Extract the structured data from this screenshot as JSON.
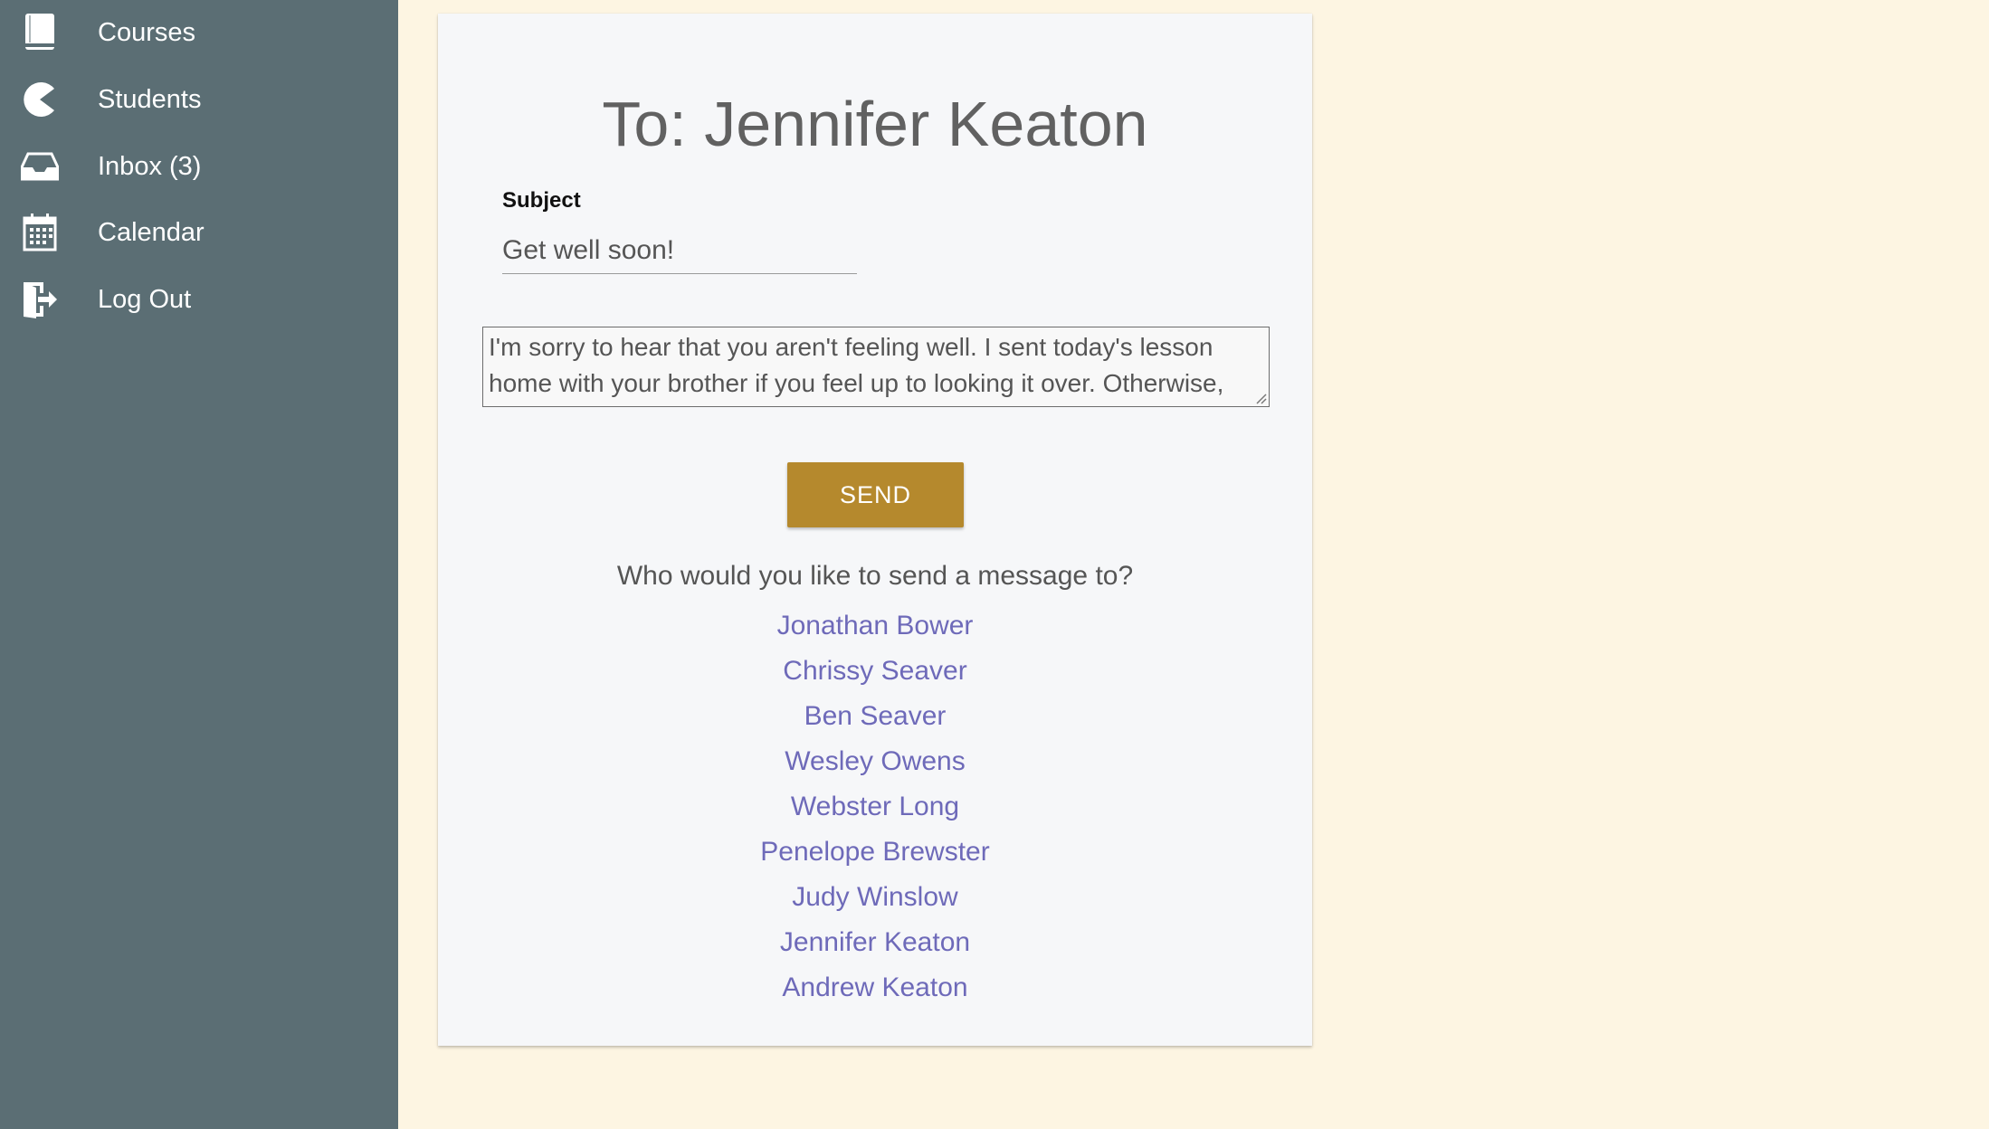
{
  "sidebar": {
    "items": [
      {
        "label": "Courses",
        "icon": "book-icon"
      },
      {
        "label": "Students",
        "icon": "pacman-icon"
      },
      {
        "label": "Inbox  (3)",
        "icon": "inbox-tray-icon"
      },
      {
        "label": "Calendar",
        "icon": "calendar-icon"
      },
      {
        "label": "Log Out",
        "icon": "logout-door-icon"
      }
    ]
  },
  "compose": {
    "title": "To: Jennifer Keaton",
    "subject_label": "Subject",
    "subject_value": "Get well soon!",
    "message_value": "I'm sorry to hear that you aren't feeling well. I sent today's lesson home with your brother if you feel up to looking it over. Otherwise, get",
    "send_label": "SEND"
  },
  "recipients": {
    "prompt": "Who would you like to send a message to?",
    "names": [
      "Jonathan Bower",
      "Chrissy Seaver",
      "Ben Seaver",
      "Wesley Owens",
      "Webster Long",
      "Penelope Brewster",
      "Judy Winslow",
      "Jennifer Keaton",
      "Andrew Keaton"
    ]
  },
  "colors": {
    "sidebar": "#5b6e74",
    "page_background": "#fdf5e2",
    "card_background": "#f6f7f9",
    "send_button": "#b5892d",
    "link": "#6e6ab9"
  }
}
